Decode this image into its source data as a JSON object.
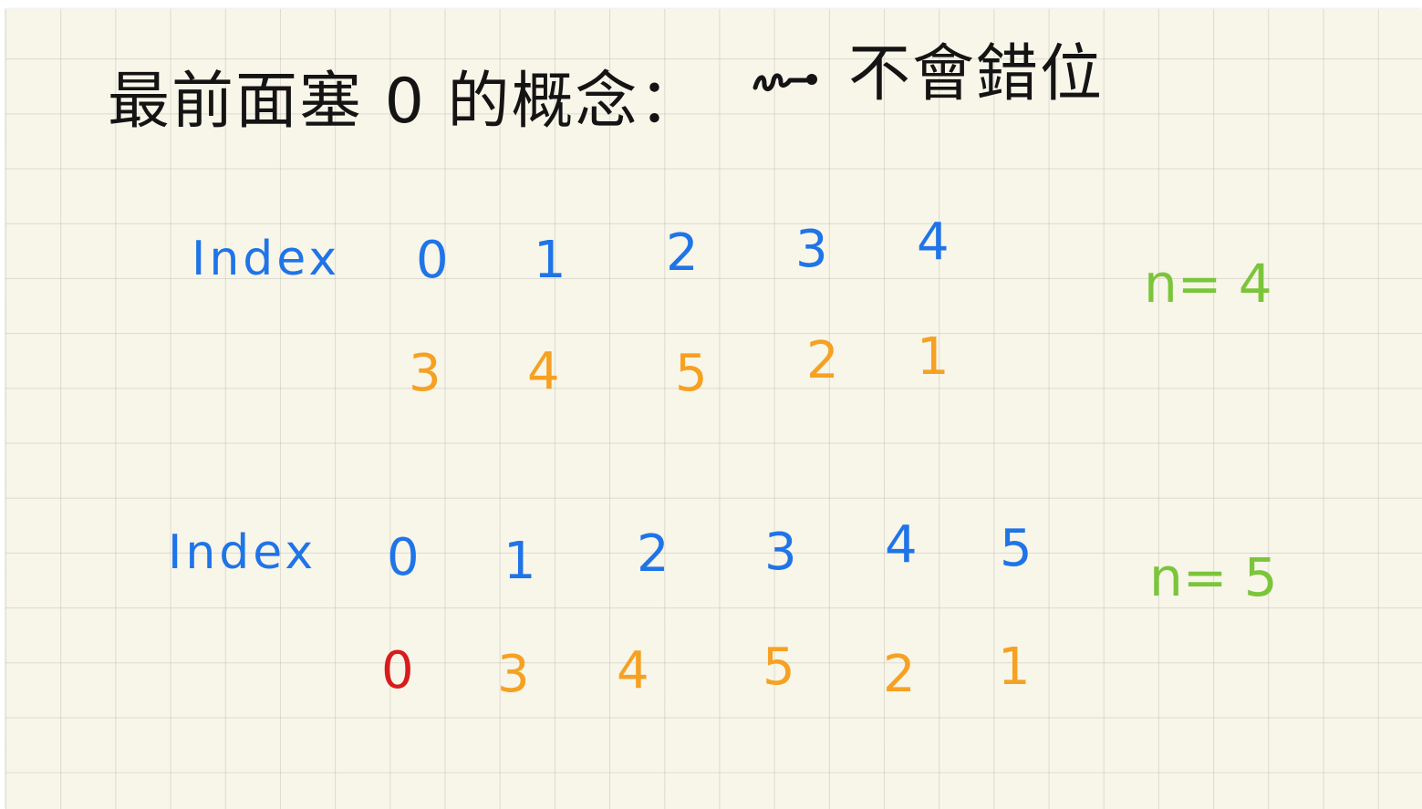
{
  "note": {
    "title_prefix": "最前面塞 0 的概念：",
    "title_suffix": "不會錯位"
  },
  "example1": {
    "index_label": "Index",
    "indices": [
      "0",
      "1",
      "2",
      "3",
      "4"
    ],
    "values": [
      "3",
      "4",
      "5",
      "2",
      "1"
    ],
    "n_label": "n= 4"
  },
  "example2": {
    "index_label": "Index",
    "indices": [
      "0",
      "1",
      "2",
      "3",
      "4",
      "5"
    ],
    "values": [
      "0",
      "3",
      "4",
      "5",
      "2",
      "1"
    ],
    "n_label": "n= 5"
  },
  "colors": {
    "paper": "#f8f5e9",
    "grid": "#c9c6bb",
    "ink_black": "#141414",
    "ink_blue": "#1f74e8",
    "ink_orange": "#f5a122",
    "ink_red": "#d71c1c",
    "ink_green": "#7bc53a"
  }
}
